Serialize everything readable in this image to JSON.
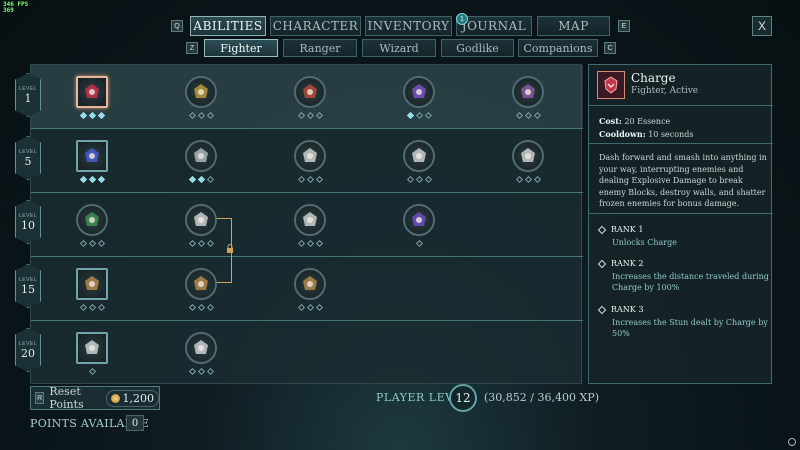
{
  "fps": {
    "line1": "346 FPS",
    "line2": "369"
  },
  "top_tabs": {
    "key_left": "Q",
    "key_right": "E",
    "items": [
      "ABILITIES",
      "CHARACTER",
      "INVENTORY",
      "JOURNAL",
      "MAP"
    ],
    "active": "ABILITIES",
    "journal_badge": "1",
    "close_label": "X"
  },
  "sub_tabs": {
    "key_left": "Z",
    "key_right": "C",
    "items": [
      "Fighter",
      "Ranger",
      "Wizard",
      "Godlike",
      "Companions"
    ],
    "active": "Fighter"
  },
  "levels": [
    {
      "word": "LEVEL",
      "num": "1"
    },
    {
      "word": "LEVEL",
      "num": "5"
    },
    {
      "word": "LEVEL",
      "num": "10"
    },
    {
      "word": "LEVEL",
      "num": "15"
    },
    {
      "word": "LEVEL",
      "num": "20"
    }
  ],
  "abilities": [
    {
      "name": "charge-ability-icon",
      "ranks": 3,
      "filled": 3,
      "selected": true
    },
    {
      "name": "heroic-armor-ability-icon",
      "ranks": 3,
      "filled": 0
    },
    {
      "name": "shield-bash-ability-icon",
      "ranks": 3,
      "filled": 0
    },
    {
      "name": "war-cry-ability-icon",
      "ranks": 3,
      "filled": 1
    },
    {
      "name": "heart-ability-icon",
      "ranks": 3,
      "filled": 0
    },
    {
      "name": "leap-ability-icon",
      "ranks": 3,
      "filled": 3
    },
    {
      "name": "banner-ability-icon",
      "ranks": 3,
      "filled": 2
    },
    {
      "name": "fist-ability-icon",
      "ranks": 3,
      "filled": 0
    },
    {
      "name": "axe-throw-ability-icon",
      "ranks": 3,
      "filled": 0
    },
    {
      "name": "double-axe-ability-icon",
      "ranks": 3,
      "filled": 0
    },
    {
      "name": "regen-ability-icon",
      "ranks": 3,
      "filled": 0
    },
    {
      "name": "shield-slash-ability-icon",
      "ranks": 3,
      "filled": 0
    },
    {
      "name": "cannon-ability-icon",
      "ranks": 3,
      "filled": 0
    },
    {
      "name": "crossed-swords-ability-icon",
      "ranks": 1,
      "filled": 0
    },
    {
      "name": "gauntlet-ability-icon",
      "ranks": 3,
      "filled": 0
    },
    {
      "name": "locked-fist-ability-icon",
      "ranks": 3,
      "filled": 0
    },
    {
      "name": "locked-glove-ability-icon",
      "ranks": 3,
      "filled": 0
    },
    {
      "name": "hammer-ability-icon",
      "ranks": 1,
      "filled": 0
    },
    {
      "name": "burst-ability-icon",
      "ranks": 3,
      "filled": 0
    }
  ],
  "detail": {
    "title": "Charge",
    "subtitle": "Fighter, Active",
    "cost_label": "Cost:",
    "cost_value": "20 Essence",
    "cooldown_label": "Cooldown:",
    "cooldown_value": "10 seconds",
    "description": "Dash forward and smash into anything in your way, interrupting enemies and dealing Explosive Damage to break enemy Blocks, destroy walls, and shatter frozen enemies for bonus damage.",
    "ranks": [
      {
        "title": "RANK 1",
        "desc": "Unlocks Charge"
      },
      {
        "title": "RANK 2",
        "desc": "Increases the distance traveled during Charge by 100%"
      },
      {
        "title": "RANK 3",
        "desc": "Increases the Stun dealt by Charge by 50%"
      }
    ]
  },
  "footer": {
    "reset_key": "R",
    "reset_label": "Reset Points",
    "reset_cost": "1,200",
    "player_level_label": "PLAYER LEVEL",
    "player_level": "12",
    "xp": "(30,852 / 36,400 XP)",
    "points_label": "POINTS AVAILABLE",
    "points_value": "0"
  }
}
